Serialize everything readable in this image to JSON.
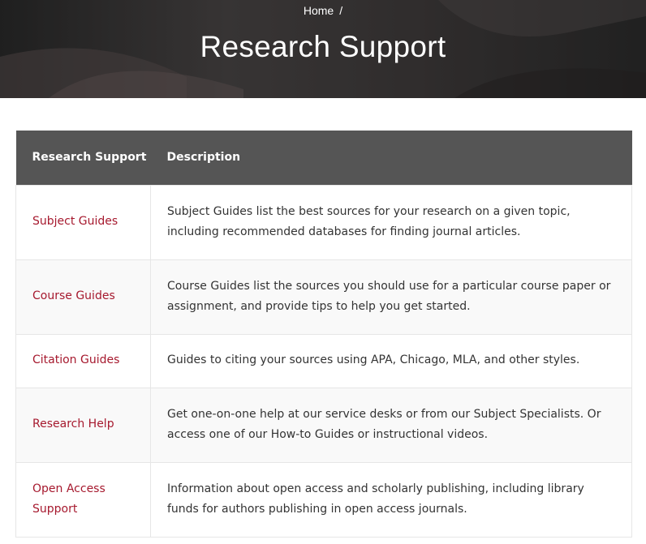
{
  "header": {
    "breadcrumb": {
      "home": "Home",
      "separator": "/"
    },
    "title": "Research Support"
  },
  "table": {
    "headers": [
      "Research Support",
      "Description"
    ],
    "rows": [
      {
        "link": "Subject Guides",
        "description": "Subject Guides list the best sources for your research on a given topic, including recommended databases for finding journal articles."
      },
      {
        "link": "Course Guides",
        "description": "Course Guides list the sources you should use for a particular course paper or assignment, and provide tips to help you get started."
      },
      {
        "link": "Citation Guides",
        "description": "Guides to citing your sources using APA, Chicago, MLA, and other styles."
      },
      {
        "link": "Research Help",
        "description": "Get one-on-one help at our service desks or from our Subject Specialists. Or access one of our How-to Guides or instructional videos."
      },
      {
        "link": "Open Access Support",
        "description": "Information about open access and scholarly publishing, including library funds for authors publishing in open access journals."
      }
    ]
  },
  "colors": {
    "link": "#a6192e",
    "header_bg": "#555555",
    "hero_bg": "#3f3f3f"
  }
}
